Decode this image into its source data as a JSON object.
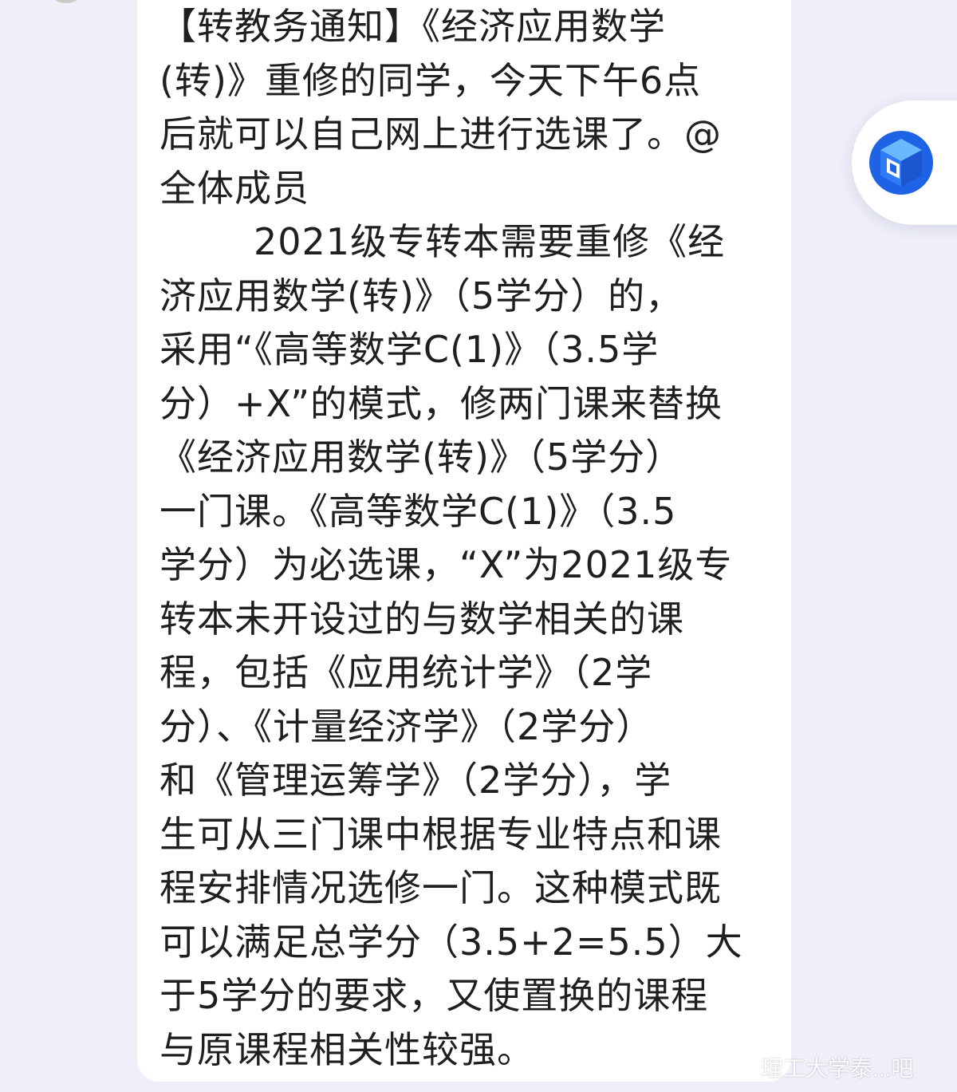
{
  "message": {
    "lines": [
      "【转教务通知】《经济应用数学",
      "(转)》重修的同学，今天下午6点",
      "后就可以自己网上进行选课了。@",
      "全体成员",
      "2021级专转本需要重修《经",
      "济应用数学(转)》（5学分）的，",
      "采用“《高等数学C(1)》（3.5学",
      "分）+X”的模式，修两门课来替换",
      "《经济应用数学(转)》（5学分）",
      "一门课。《高等数学C(1)》（3.5",
      "学分）为必选课，“X”为2021级专",
      "转本未开设过的与数学相关的课",
      "程，包括《应用统计学》（2学",
      "分）、《计量经济学》（2学分）",
      "和《管理运筹学》（2学分），学",
      "生可从三门课中根据专业特点和课",
      "程安排情况选修一门。这种模式既",
      "可以满足总学分（3.5+2=5.5）大",
      "于5学分的要求，又使置换的课程",
      "与原课程相关性较强。"
    ]
  },
  "floating_button": {
    "icon": "cube-app-icon",
    "colors": {
      "light": "#4aa3ff",
      "dark": "#1e63e6"
    }
  },
  "watermark": {
    "text": "理工大学泰...吧"
  },
  "colors": {
    "background": "#eeeff9",
    "bubble": "#ffffff",
    "text": "#1f1f1f"
  }
}
